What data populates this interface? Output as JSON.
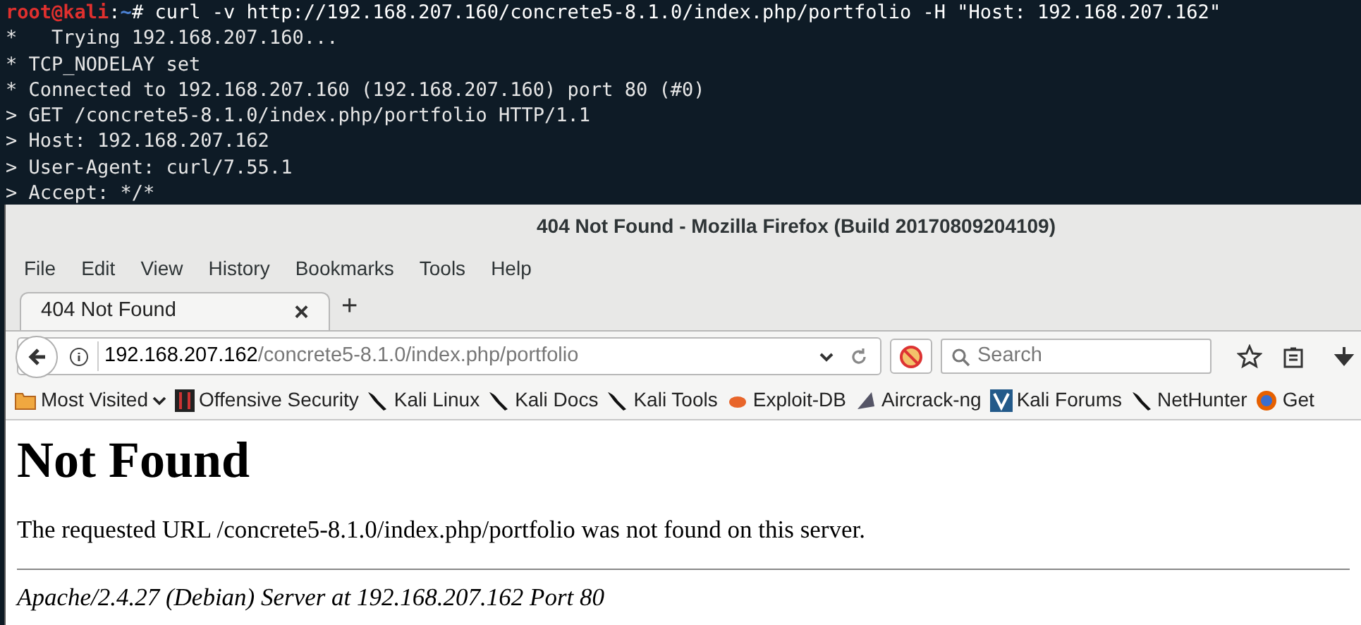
{
  "terminal": {
    "prompt": {
      "user": "root@kali",
      "separator": ":",
      "path": "~",
      "symbol": "#",
      "command": "curl -v http://192.168.207.160/concrete5-8.1.0/index.php/portfolio -H \"Host: 192.168.207.162\""
    },
    "lines": [
      "*   Trying 192.168.207.160...",
      "* TCP_NODELAY set",
      "* Connected to 192.168.207.160 (192.168.207.160) port 80 (#0)",
      "> GET /concrete5-8.1.0/index.php/portfolio HTTP/1.1",
      "> Host: 192.168.207.162",
      "> User-Agent: curl/7.55.1",
      "> Accept: */*"
    ]
  },
  "window": {
    "title": "404 Not Found - Mozilla Firefox (Build 20170809204109)"
  },
  "menu": [
    "File",
    "Edit",
    "View",
    "History",
    "Bookmarks",
    "Tools",
    "Help"
  ],
  "tabs": [
    {
      "label": "404 Not Found",
      "selected": true,
      "close": "×"
    }
  ],
  "new_tab": "+",
  "url_bar": {
    "host": "192.168.207.162",
    "path": "/concrete5-8.1.0/index.php/portfolio"
  },
  "search": {
    "placeholder": "Search"
  },
  "bookmarks": [
    {
      "label": "Most Visited",
      "kind": "folder"
    },
    {
      "label": "Offensive Security",
      "kind": "offsec"
    },
    {
      "label": "Kali Linux",
      "kind": "kali"
    },
    {
      "label": "Kali Docs",
      "kind": "kali"
    },
    {
      "label": "Kali Tools",
      "kind": "kali"
    },
    {
      "label": "Exploit-DB",
      "kind": "exploit"
    },
    {
      "label": "Aircrack-ng",
      "kind": "aircrack"
    },
    {
      "label": "Kali Forums",
      "kind": "forums"
    },
    {
      "label": "NetHunter",
      "kind": "kali"
    },
    {
      "label": "Get",
      "kind": "firefox"
    }
  ],
  "page": {
    "heading": "Not Found",
    "message": "The requested URL /concrete5-8.1.0/index.php/portfolio was not found on this server.",
    "signature": "Apache/2.4.27 (Debian) Server at 192.168.207.162 Port 80"
  }
}
